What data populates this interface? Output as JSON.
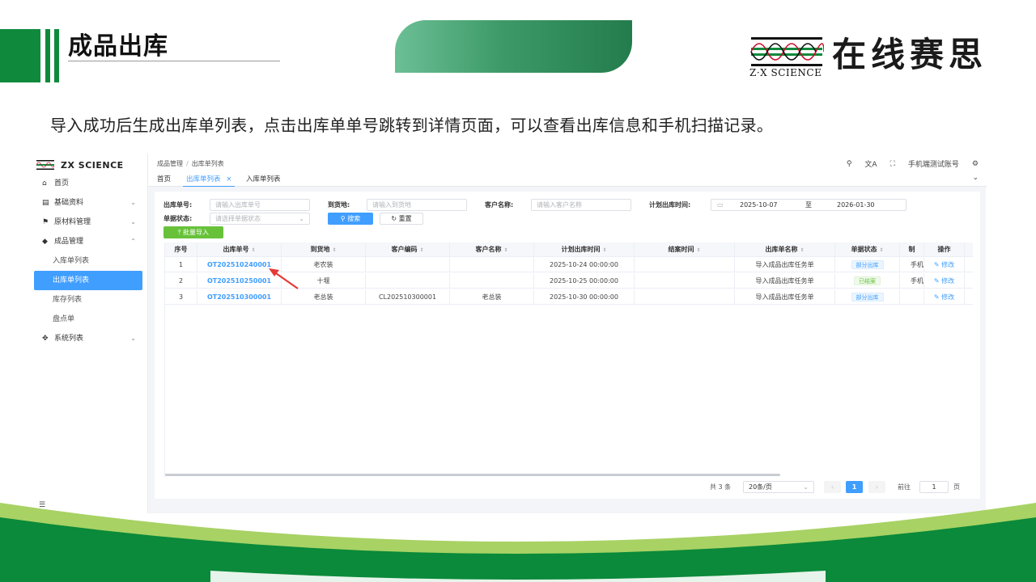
{
  "slide": {
    "title": "成品出库",
    "description": "导入成功后生成出库单列表，点击出库单单号跳转到详情页面，可以查看出库信息和手机扫描记录。",
    "logo_subtitle": "Z·X SCIENCE",
    "logo_cn": "在线赛思",
    "colors": {
      "brand_green": "#0f8a3c",
      "accent_blue": "#409eff"
    }
  },
  "app": {
    "brand": "ZX SCIENCE",
    "nav": [
      {
        "label": "首页",
        "icon": "home-icon"
      },
      {
        "label": "基础资料",
        "icon": "grid-icon"
      },
      {
        "label": "原材料管理",
        "icon": "flag-icon"
      },
      {
        "label": "成品管理",
        "icon": "cube-icon"
      },
      {
        "label": "入库单列表"
      },
      {
        "label": "出库单列表"
      },
      {
        "label": "库存列表"
      },
      {
        "label": "盘点单"
      },
      {
        "label": "系统列表",
        "icon": "settings-icon"
      }
    ],
    "breadcrumb": [
      "成品管理",
      "出库单列表"
    ],
    "account": "手机端测试账号",
    "tabs": [
      "首页",
      "出库单列表",
      "入库单列表"
    ],
    "filters": {
      "order_no_label": "出库单号:",
      "order_no_placeholder": "请输入出库单号",
      "dest_label": "到货地:",
      "dest_placeholder": "请输入到货地",
      "customer_label": "客户名称:",
      "customer_placeholder": "请输入客户名称",
      "plan_time_label": "计划出库时间:",
      "date_start": "2025-10-07",
      "date_sep": "至",
      "date_end": "2026-01-30",
      "status_label": "单据状态:",
      "status_placeholder": "请选择单据状态",
      "search_btn": "搜索",
      "reset_btn": "重置",
      "import_btn": "批量导入"
    },
    "table": {
      "columns": [
        "序号",
        "出库单号",
        "到货地",
        "客户编码",
        "客户名称",
        "计划出库时间",
        "结案时间",
        "出库单名称",
        "单据状态",
        "制",
        "操作"
      ],
      "rows": [
        [
          "1",
          "OT202510240001",
          "老农装",
          "",
          "",
          "2025-10-24 00:00:00",
          "",
          "导入成品出库任务单",
          "部分出库",
          "手机",
          "修改"
        ],
        [
          "2",
          "OT202510250001",
          "十堰",
          "",
          "",
          "2025-10-25 00:00:00",
          "",
          "导入成品出库任务单",
          "已结案",
          "手机",
          "修改"
        ],
        [
          "3",
          "OT202510300001",
          "老总装",
          "CL202510300001",
          "老总装",
          "2025-10-30 00:00:00",
          "",
          "导入成品出库任务单",
          "部分出库",
          "",
          "修改"
        ]
      ]
    },
    "pagination": {
      "total": "共 3 条",
      "page_size": "20条/页",
      "current": "1",
      "goto": "前往",
      "goto_value": "1",
      "page_unit": "页"
    }
  }
}
